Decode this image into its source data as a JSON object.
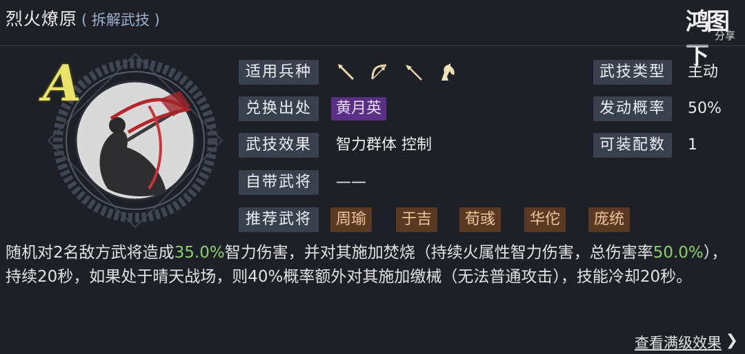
{
  "header": {
    "skill_name": "烈火燎原",
    "skill_sub": "( 拆解武技 )"
  },
  "logo": {
    "mark": "鸿图下",
    "sub": "分享"
  },
  "emblem": {
    "grade": "A"
  },
  "labels": {
    "troops": "适用兵种",
    "source": "兑换出处",
    "effect": "武技效果",
    "own_general": "自带武将",
    "recommend": "推荐武将",
    "type": "武技类型",
    "rate": "发动概率",
    "slots": "可装配数"
  },
  "values": {
    "source": "黄月英",
    "effect": "智力群体 控制",
    "own_general": "——",
    "type": "主动",
    "rate": "50%",
    "slots": "1"
  },
  "weapon_icons": [
    "spear-icon",
    "bow-icon",
    "lance-icon",
    "horse-icon"
  ],
  "recommended_generals": [
    "周瑜",
    "于吉",
    "荀彧",
    "华佗",
    "庞统"
  ],
  "description": {
    "p1": "随机对2名敌方武将造成",
    "v1": "35.0%",
    "p2": "智力伤害，并对其施加焚烧（持续火属性智力伤害，总伤害率",
    "v2": "50.0%",
    "p3": "），持续20秒，如果处于晴天战场，则40%概率额外对其施加缴械（无法普通攻击），技能冷却20秒。"
  },
  "footer": {
    "more_link": "查看满级效果",
    "arrow": "❯",
    "badge": ""
  }
}
